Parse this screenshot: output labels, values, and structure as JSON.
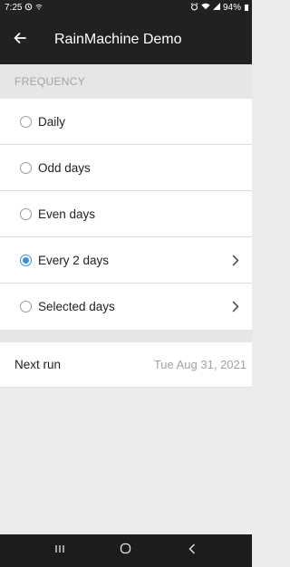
{
  "status_bar": {
    "time": "7:25",
    "battery": "94%",
    "icons": [
      "sync-icon",
      "wifi-small-icon",
      "alarm-icon",
      "wifi-icon",
      "signal-icon",
      "battery-icon"
    ]
  },
  "app_bar": {
    "title": "RainMachine Demo",
    "back_icon": "arrow-left-icon"
  },
  "frequency": {
    "header": "FREQUENCY",
    "options": [
      {
        "label": "Daily",
        "selected": false,
        "has_chevron": false
      },
      {
        "label": "Odd days",
        "selected": false,
        "has_chevron": false
      },
      {
        "label": "Even days",
        "selected": false,
        "has_chevron": false
      },
      {
        "label": "Every 2 days",
        "selected": true,
        "has_chevron": true
      },
      {
        "label": "Selected days",
        "selected": false,
        "has_chevron": true
      }
    ]
  },
  "next_run": {
    "label": "Next run",
    "value": "Tue Aug 31, 2021"
  },
  "nav_bar": {
    "buttons": [
      "recents-icon",
      "home-icon",
      "back-icon"
    ]
  },
  "colors": {
    "accent": "#3f8fd8",
    "app_bar": "#212121",
    "background": "#ececec"
  }
}
